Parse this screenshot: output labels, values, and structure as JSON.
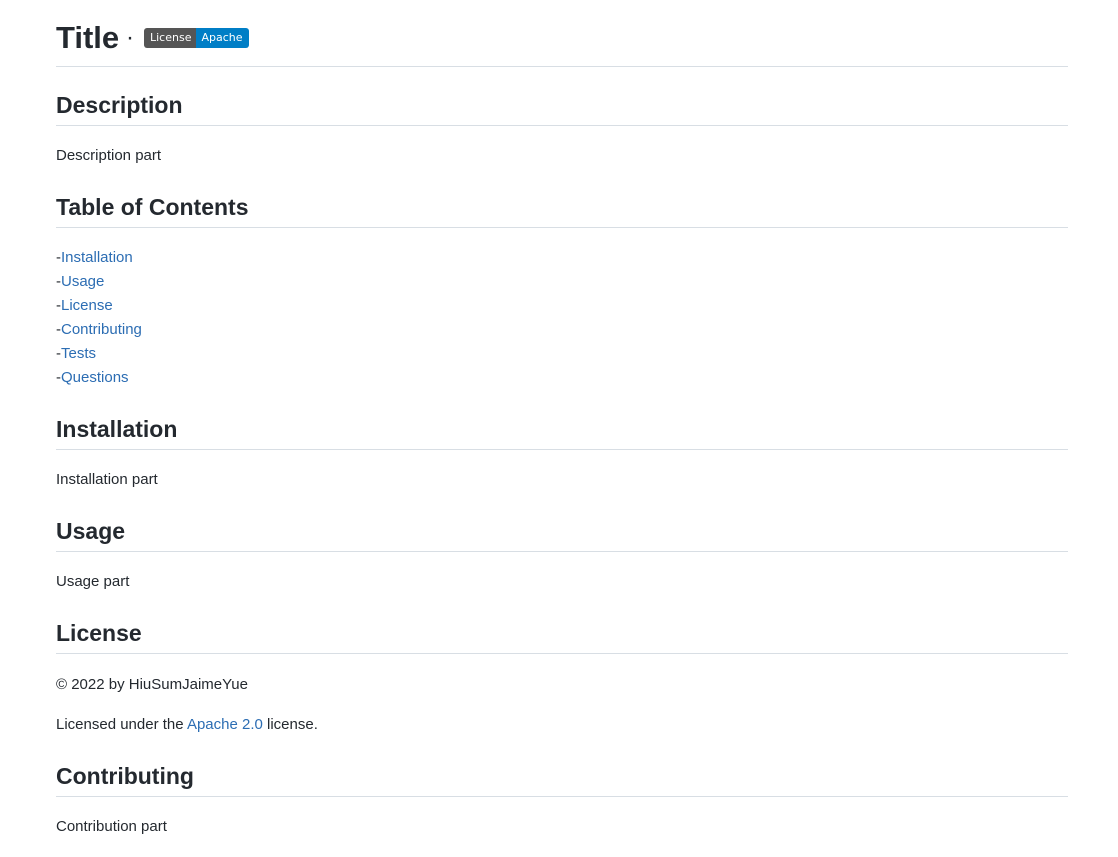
{
  "title": "Title",
  "title_separator": "·",
  "badge": {
    "label": "License",
    "value": "Apache",
    "label_color": "#555555",
    "value_color": "#007ec6"
  },
  "description": {
    "heading": "Description",
    "text": "Description part"
  },
  "toc": {
    "heading": "Table of Contents",
    "prefix": "-",
    "items": [
      "Installation",
      "Usage",
      "License",
      "Contributing",
      "Tests",
      "Questions"
    ]
  },
  "installation": {
    "heading": "Installation",
    "text": "Installation part"
  },
  "usage": {
    "heading": "Usage",
    "text": "Usage part"
  },
  "license": {
    "heading": "License",
    "copyright": "© 2022 by HiuSumJaimeYue",
    "licensed_prefix": "Licensed under the ",
    "licensed_link": "Apache 2.0",
    "licensed_suffix": " license."
  },
  "contributing": {
    "heading": "Contributing",
    "text": "Contribution part"
  },
  "colors": {
    "link": "#2c6db3",
    "text": "#24292f",
    "rule": "#d8dee4"
  }
}
